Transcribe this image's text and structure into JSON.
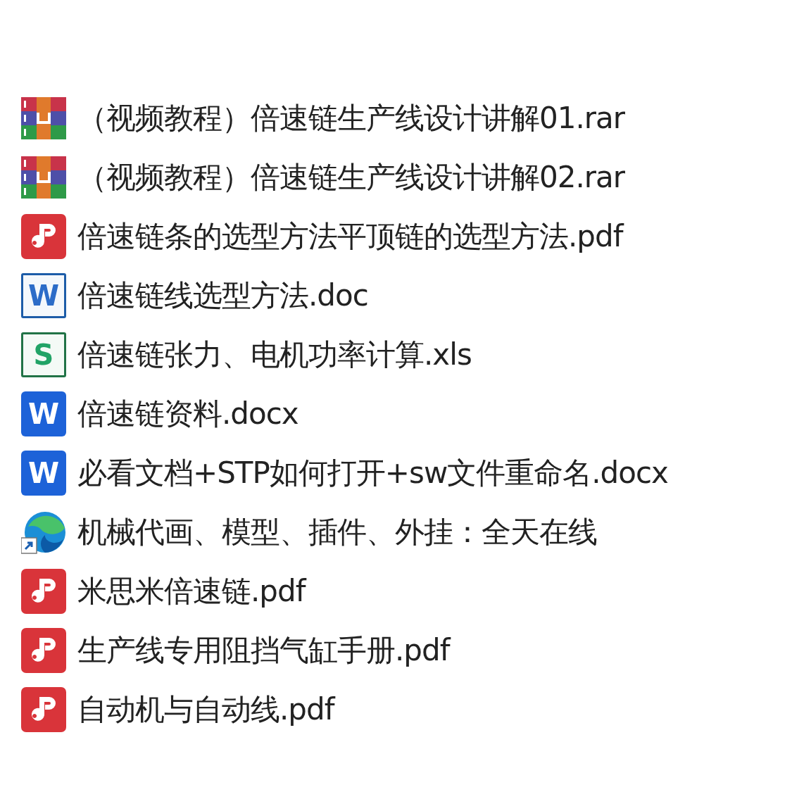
{
  "files": [
    {
      "kind": "rar",
      "name": "（视频教程）倍速链生产线设计讲解01.rar"
    },
    {
      "kind": "rar",
      "name": "（视频教程）倍速链生产线设计讲解02.rar"
    },
    {
      "kind": "pdf",
      "name": "倍速链条的选型方法平顶链的选型方法.pdf"
    },
    {
      "kind": "doc",
      "icon_letter": "W",
      "name": "倍速链线选型方法.doc"
    },
    {
      "kind": "xls",
      "icon_letter": "S",
      "name": "倍速链张力、电机功率计算.xls"
    },
    {
      "kind": "docx",
      "icon_letter": "W",
      "name": "倍速链资料.docx"
    },
    {
      "kind": "docx",
      "icon_letter": "W",
      "name": "必看文档+STP如何打开+sw文件重命名.docx"
    },
    {
      "kind": "shortcut",
      "name": "机械代画、模型、插件、外挂：全天在线"
    },
    {
      "kind": "pdf",
      "name": "米思米倍速链.pdf"
    },
    {
      "kind": "pdf",
      "name": "生产线专用阻挡气缸手册.pdf"
    },
    {
      "kind": "pdf",
      "name": "自动机与自动线.pdf"
    }
  ]
}
